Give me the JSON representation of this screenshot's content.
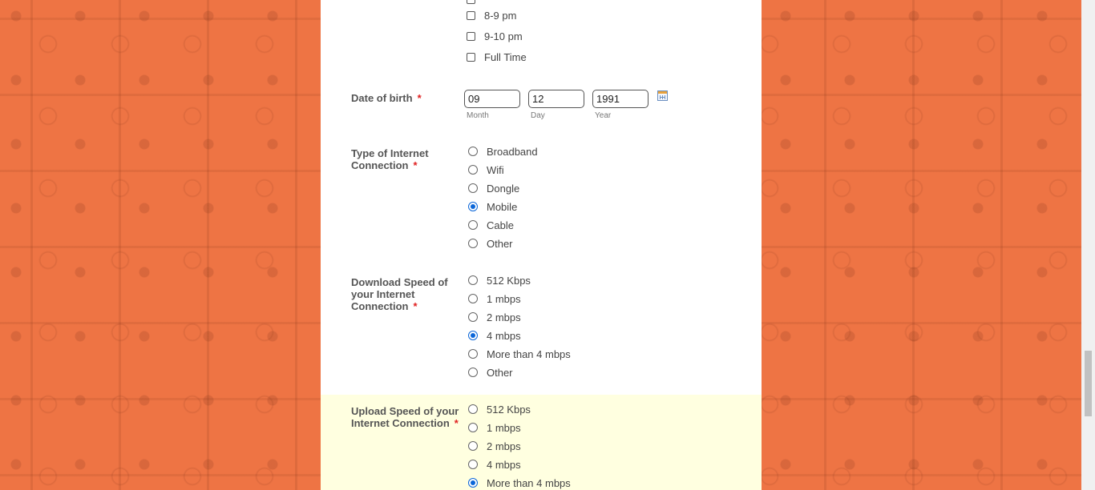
{
  "hours_options": [
    {
      "label": "8-9 pm",
      "checked": false
    },
    {
      "label": "9-10 pm",
      "checked": false
    },
    {
      "label": "Full Time",
      "checked": false
    }
  ],
  "dob": {
    "label": "Date of birth",
    "required_mark": "*",
    "month": {
      "value": "09",
      "sublabel": "Month"
    },
    "day": {
      "value": "12",
      "sublabel": "Day"
    },
    "year": {
      "value": "1991",
      "sublabel": "Year"
    }
  },
  "connection_type": {
    "label_line1": "Type of Internet",
    "label_line2": "Connection",
    "required_mark": "*",
    "options": [
      "Broadband",
      "Wifi",
      "Dongle",
      "Mobile",
      "Cable",
      "Other"
    ],
    "selected": "Mobile"
  },
  "download_speed": {
    "label_line1": "Download Speed of",
    "label_line2": "your Internet",
    "label_line3": "Connection",
    "required_mark": "*",
    "options": [
      "512 Kbps",
      "1 mbps",
      "2 mbps",
      "4 mbps",
      "More than 4 mbps",
      "Other"
    ],
    "selected": "4 mbps"
  },
  "upload_speed": {
    "label_line1": "Upload Speed of your",
    "label_line2": "Internet Connection",
    "required_mark": "*",
    "options": [
      "512 Kbps",
      "1 mbps",
      "2 mbps",
      "4 mbps",
      "More than 4 mbps"
    ],
    "selected": "More than 4 mbps"
  },
  "icons": {
    "calendar": "calendar-icon"
  },
  "colors": {
    "background": "#ee7444",
    "highlight": "#ffffe0",
    "required": "#e02020",
    "radio_selected": "#0b66d8"
  }
}
